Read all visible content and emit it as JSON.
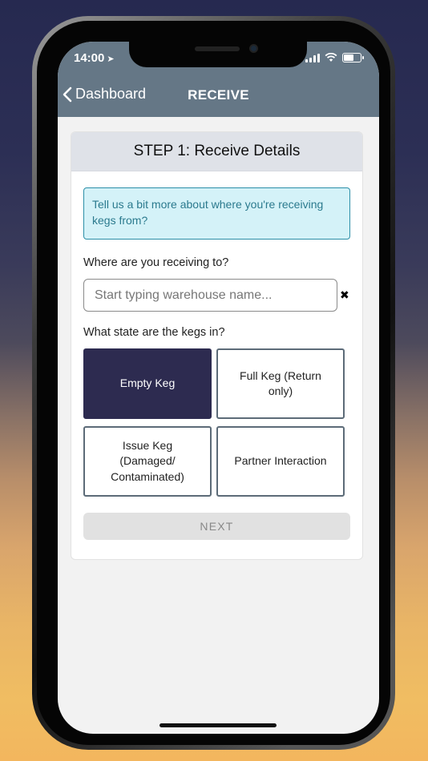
{
  "status": {
    "time": "14:00"
  },
  "nav": {
    "back_label": "Dashboard",
    "title": "RECEIVE"
  },
  "step": {
    "title": "STEP 1: Receive Details",
    "info": "Tell us a bit more about where you're receiving kegs from?",
    "receiving_label": "Where are you receiving to?",
    "warehouse_placeholder": "Start typing warehouse name...",
    "state_label": "What state are the kegs in?",
    "options": [
      {
        "label": "Empty Keg",
        "selected": true
      },
      {
        "label": "Full Keg (Return only)",
        "selected": false
      },
      {
        "label": "Issue Keg (Damaged/ Contaminated)",
        "selected": false
      },
      {
        "label": "Partner Interaction",
        "selected": false
      }
    ],
    "next_label": "NEXT"
  },
  "colors": {
    "nav_bar": "#657786",
    "selected_option": "#2d2b50",
    "info_bg": "#d4f2f8",
    "info_text": "#2b7a8e"
  }
}
